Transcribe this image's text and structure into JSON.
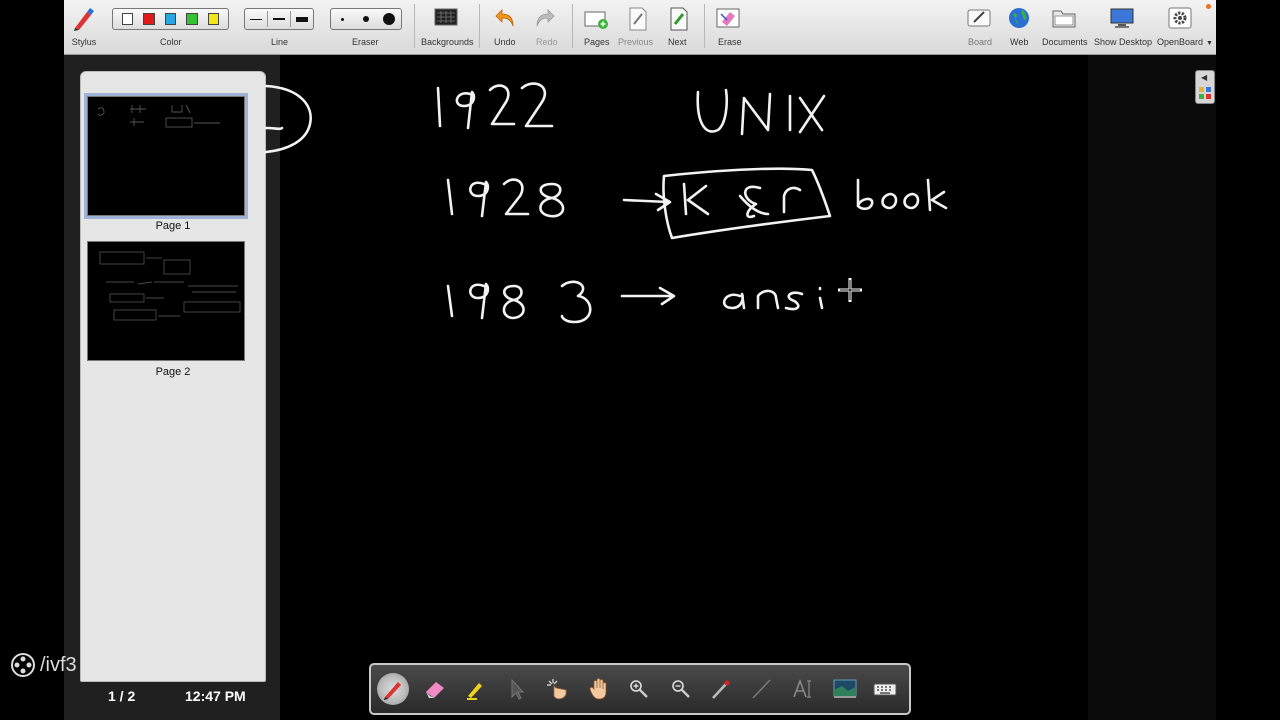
{
  "toolbar": {
    "stylus": "Stylus",
    "color": "Color",
    "line": "Line",
    "eraser": "Eraser",
    "backgrounds": "Backgrounds",
    "undo": "Undo",
    "redo": "Redo",
    "pages": "Pages",
    "previous": "Previous",
    "next": "Next",
    "erase": "Erase",
    "board": "Board",
    "web": "Web",
    "documents": "Documents",
    "show_desktop": "Show Desktop",
    "openboard": "OpenBoard",
    "colors": [
      "#ffffff",
      "#e01b1b",
      "#2aa7e0",
      "#35c235",
      "#f2e51b"
    ]
  },
  "pages_panel": {
    "pages": [
      {
        "label": "Page 1",
        "selected": true
      },
      {
        "label": "Page 2",
        "selected": false
      }
    ],
    "page_indicator": "1 / 2",
    "clock": "12:47 PM"
  },
  "board": {
    "ink_text": [
      "1922",
      "UNIX",
      "1928",
      "K&R",
      "book",
      "1983",
      "ansi"
    ]
  },
  "palette": {
    "tools": [
      "pen-icon",
      "eraser-icon",
      "highlighter-icon",
      "selector-icon",
      "interact-icon",
      "hand-icon",
      "zoom-in-icon",
      "zoom-out-icon",
      "laser-pointer-icon",
      "line-icon",
      "text-icon",
      "capture-icon",
      "keyboard-icon"
    ]
  },
  "watermark": "/ivf3"
}
